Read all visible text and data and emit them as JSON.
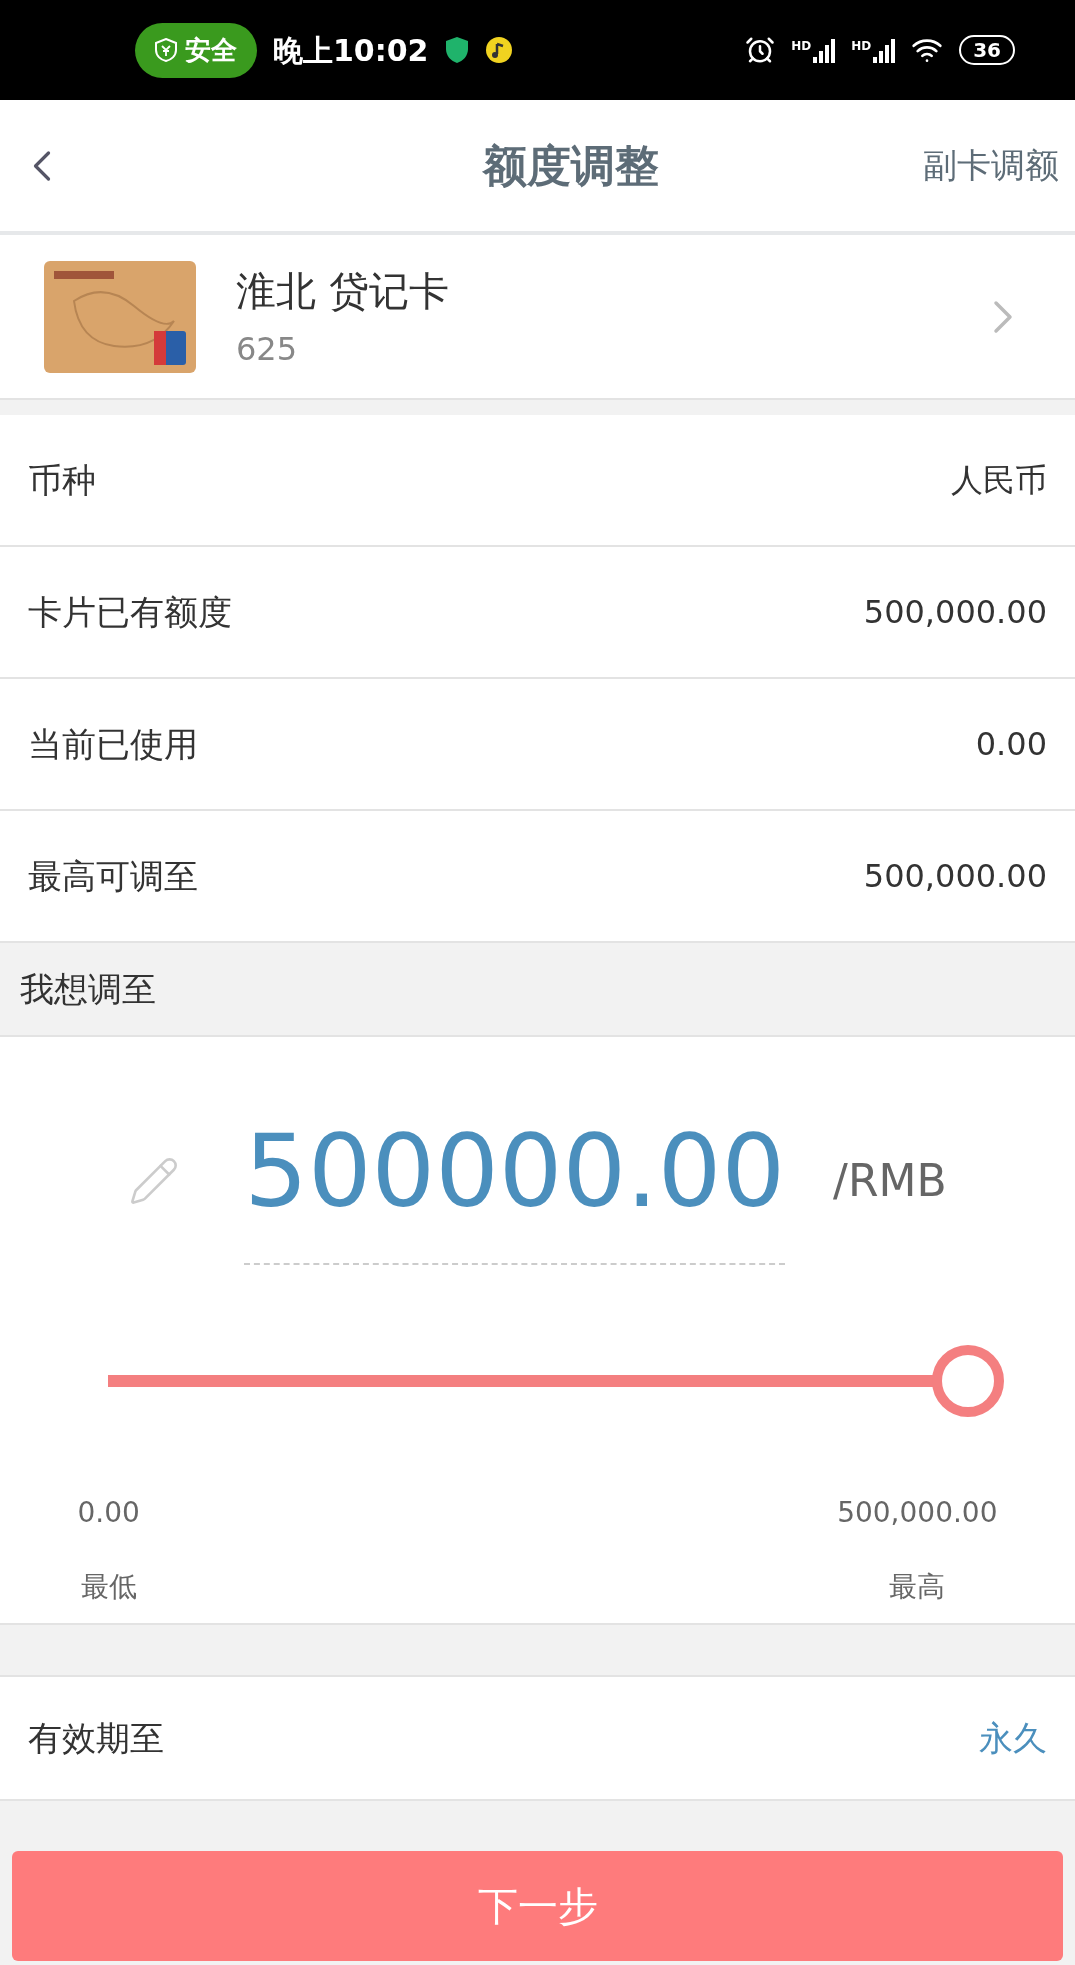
{
  "status_bar": {
    "security_badge": "安全",
    "time": "晚上10:02",
    "signals": [
      "HD",
      "HD"
    ],
    "battery": "36"
  },
  "header": {
    "title": "额度调整",
    "action": "副卡调额"
  },
  "card": {
    "name": "淮北 贷记卡",
    "number": "625"
  },
  "info_rows": [
    {
      "label": "币种",
      "value": "人民币"
    },
    {
      "label": "卡片已有额度",
      "value": "500,000.00"
    },
    {
      "label": "当前已使用",
      "value": "0.00"
    },
    {
      "label": "最高可调至",
      "value": "500,000.00"
    }
  ],
  "adjust": {
    "section_title": "我想调至",
    "amount": "500000.00",
    "unit": "/RMB",
    "slider": {
      "level": 1,
      "min_value": "0.00",
      "max_value": "500,000.00",
      "min_label": "最低",
      "max_label": "最高"
    }
  },
  "validity": {
    "label": "有效期至",
    "value": "永久"
  },
  "next_button": "下一步"
}
